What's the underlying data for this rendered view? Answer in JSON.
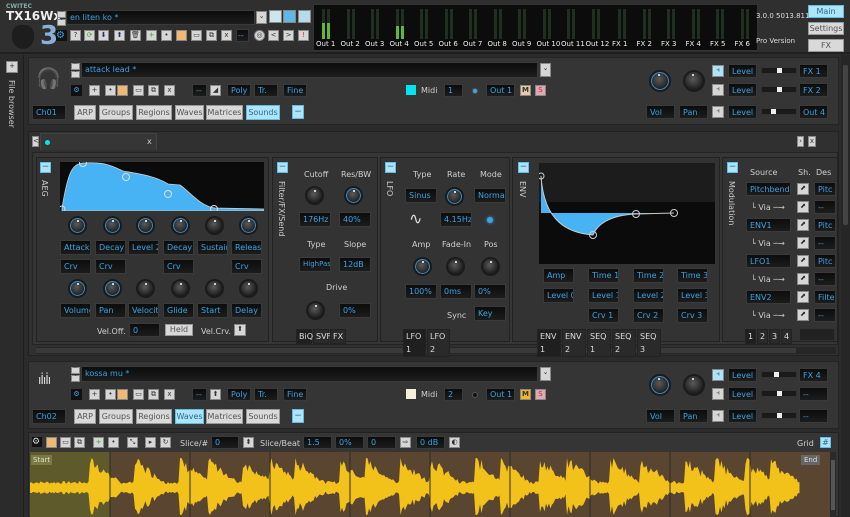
{
  "app": {
    "brand": "CWITEC",
    "title": "TX16Wx",
    "version_num": "3",
    "version": "3.0.0 5013.811",
    "edition": "Pro Version"
  },
  "top": {
    "preset": "en liten ko *",
    "nav": [
      "Main",
      "Settings",
      "FX"
    ],
    "active_nav": "Main",
    "outputs": [
      "Out 1",
      "Out 2",
      "Out 3",
      "Out 4",
      "Out 5",
      "Out 6",
      "Out 7",
      "Out 8",
      "Out 9",
      "Out 10",
      "Out 11",
      "Out 12",
      "FX 1",
      "FX 2",
      "FX 3",
      "FX 4",
      "FX 5",
      "FX 6"
    ],
    "meter_levels": [
      0.55,
      0,
      0,
      0.45,
      0,
      0,
      0,
      0,
      0,
      0,
      0,
      0,
      0,
      0,
      0,
      0,
      0,
      0
    ],
    "toolbar_dash": "--",
    "toolbar_buttons": [
      "?",
      "<",
      ">",
      "!"
    ]
  },
  "sidebar": {
    "add": "+",
    "file_browser": "File browser"
  },
  "ch1": {
    "preset": "attack lead *",
    "channel": "Ch01",
    "dash": "--",
    "poly": "Poly",
    "tr": "Tr.",
    "fine": "Fine",
    "midi_label": "Midi",
    "midi": "1",
    "out": "Out 1",
    "mute": "M",
    "solo": "S",
    "tabs": [
      "ARP",
      "Groups",
      "Regions",
      "Waves",
      "Matrices",
      "Sounds"
    ],
    "active_tab": "Sounds",
    "collapse": "−",
    "vol": "Vol",
    "pan": "Pan",
    "sends": [
      {
        "label": "Level",
        "dest": "FX 1",
        "value": 0.5
      },
      {
        "label": "Level",
        "dest": "FX 2",
        "value": 0.5
      },
      {
        "label": "Level",
        "dest": "Out 4",
        "value": 0.3
      }
    ],
    "color": "#00e5f0"
  },
  "editor": {
    "close": "x",
    "prev": "<",
    "next": ">",
    "aeg": {
      "title": "AEG",
      "params": [
        "Attack",
        "Decay 1",
        "Level 2",
        "Decay 2",
        "Sustain",
        "Release"
      ],
      "curves": [
        "Crv",
        "Crv",
        "",
        "Crv",
        "",
        "Crv"
      ],
      "params2": [
        "Volume",
        "Pan",
        "Velocity",
        "Glide",
        "Start",
        "Delay"
      ],
      "vel_off_label": "Vel.Off.",
      "vel_off": "0",
      "held": "Held",
      "vel_crv": "Vel.Crv."
    },
    "filter": {
      "title": "Filter/FX/Send",
      "cutoff": "Cutoff",
      "res": "Res/BW",
      "cutoff_val": "176Hz",
      "res_val": "40%",
      "type": "Type",
      "slope": "Slope",
      "type_val": "HighPass",
      "slope_val": "12dB",
      "drive": "Drive",
      "drive_val": "0%",
      "tabs": [
        "BiQ",
        "SVF",
        "FX"
      ]
    },
    "lfo": {
      "title": "LFO",
      "type": "Type",
      "rate": "Rate",
      "mode": "Mode",
      "type_val": "Sinus",
      "rate_val": "4.15Hz",
      "mode_val": "Normal",
      "amp": "Amp",
      "fade": "Fade-In",
      "pos": "Pos",
      "amp_val": "100%",
      "fade_val": "0ms",
      "pos_val": "0%",
      "sync": "Sync",
      "sync_val": "Key",
      "tabs": [
        "LFO 1",
        "LFO 2"
      ]
    },
    "env": {
      "title": "ENV",
      "row1": [
        "Amp",
        "Time 1",
        "Time 2",
        "Time 3"
      ],
      "row2": [
        "Level 0",
        "Level 1",
        "Level 2",
        "Level 3"
      ],
      "row3": [
        "Crv 1",
        "Crv 2",
        "Crv 3"
      ],
      "tabs": [
        "ENV 1",
        "ENV 2",
        "SEQ 1",
        "SEQ 2",
        "SEQ 3"
      ]
    },
    "mod": {
      "title": "Modulation",
      "source": "Source",
      "sh": "Sh.",
      "dest": "Des",
      "rows": [
        {
          "src": "Pitchbend",
          "dst": "Pitc"
        },
        {
          "src": "└ Via ─→",
          "dst": "--"
        },
        {
          "src": "ENV1",
          "dst": "Pitc"
        },
        {
          "src": "└ Via ─→",
          "dst": "--"
        },
        {
          "src": "LFO1",
          "dst": "Pitc"
        },
        {
          "src": "└ Via ─→",
          "dst": "--"
        },
        {
          "src": "ENV2",
          "dst": "Filte"
        },
        {
          "src": "└ Via ─→",
          "dst": "--"
        }
      ],
      "pages": [
        "1",
        "2",
        "3",
        "4"
      ]
    }
  },
  "ch2": {
    "preset": "kossa mu *",
    "channel": "Ch02",
    "dash": "--",
    "poly": "Poly",
    "tr": "Tr.",
    "fine": "Fine",
    "midi_label": "Midi",
    "midi": "2",
    "out": "Out 1",
    "mute": "M",
    "solo": "S",
    "tabs": [
      "ARP",
      "Groups",
      "Regions",
      "Waves",
      "Matrices",
      "Sounds"
    ],
    "active_tab": "Waves",
    "collapse": "−",
    "vol": "Vol",
    "pan": "Pan",
    "sends": [
      {
        "label": "Level",
        "dest": "FX 4",
        "value": 0.4
      },
      {
        "label": "Level",
        "dest": "--",
        "value": 0.5
      },
      {
        "label": "Level",
        "dest": "--",
        "value": 0.5
      }
    ],
    "color": "#f4f1d8"
  },
  "wave": {
    "slice_label": "Slice/#",
    "slice": "0",
    "slice_beat_label": "Slice/Beat",
    "slice_beat": "1.5",
    "pct": "0%",
    "val": "0",
    "gain": "0 dB",
    "grid": "Grid",
    "start": "Start",
    "end": "End"
  }
}
